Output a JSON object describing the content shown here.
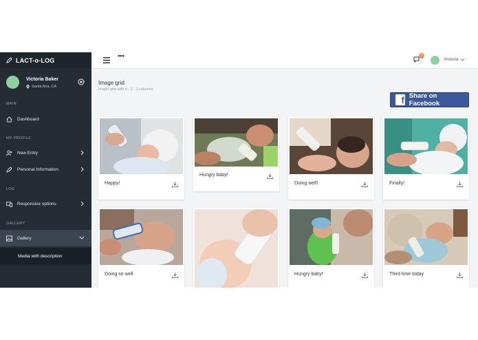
{
  "brand": "LACT-o-LOG",
  "profile": {
    "name": "Victoria Baker",
    "location": "Santa Ana, CA"
  },
  "sidebar": {
    "sections": [
      "MAIN",
      "MY PROFILE",
      "LOG",
      "GALLERY"
    ],
    "items": [
      {
        "label": "Dashboard",
        "icon": "home-icon"
      },
      {
        "label": "New Entry",
        "icon": "user-plus-icon"
      },
      {
        "label": "Personal Information",
        "icon": "pencil-icon"
      },
      {
        "label": "Responsive options",
        "icon": "responsive-icon"
      },
      {
        "label": "Gallery",
        "icon": "image-icon"
      }
    ],
    "sub_item": "Media with description"
  },
  "topbar": {
    "notifications": "3",
    "user": "Victoria"
  },
  "page": {
    "title": "Image grid",
    "subtitle": "Image grid with 4 - 2 - 1 columns"
  },
  "facebook_button": "Share on Facebook",
  "cards": [
    {
      "caption": "Happy!"
    },
    {
      "caption": "Hungry baby!"
    },
    {
      "caption": "Doing well!"
    },
    {
      "caption": "Finally!"
    },
    {
      "caption": "Doing so well"
    },
    {
      "caption": ""
    },
    {
      "caption": "Hungry baby!"
    },
    {
      "caption": "Third time today"
    }
  ],
  "colors": {
    "sidebar": "#252c33",
    "facebook": "#3b5998",
    "avatar": "#8fd19e",
    "badge": "#f08a5d"
  }
}
